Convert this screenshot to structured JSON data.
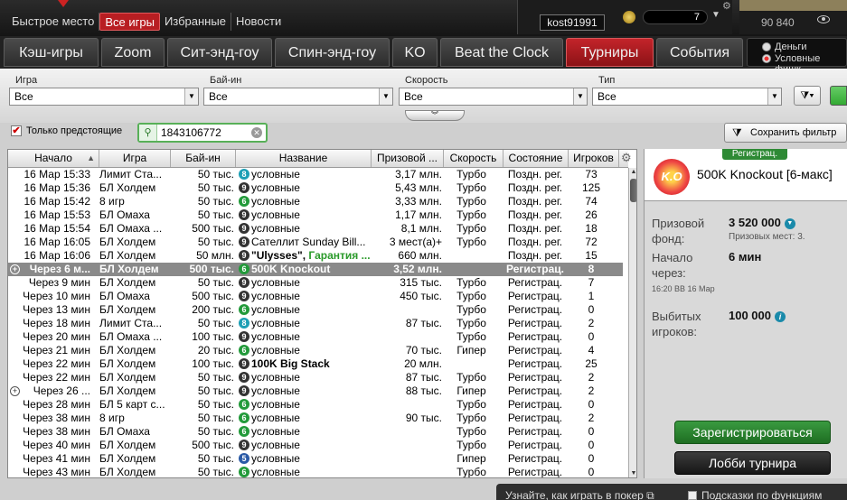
{
  "topnav": {
    "items": [
      "Быстрое место",
      "Все игры",
      "Избранные",
      "Новости"
    ],
    "active_index": 1
  },
  "user": {
    "name": "kost91991",
    "chips": "7",
    "balance": "90 840"
  },
  "tabs": [
    "Кэш-игры",
    "Zoom",
    "Сит-энд-гоу",
    "Спин-энд-гоу",
    "KO",
    "Beat the Clock",
    "Турниры",
    "События"
  ],
  "active_tab": "Турниры",
  "money": {
    "options": [
      "Деньги",
      "Условные фишк"
    ],
    "selected": "Условные фишк"
  },
  "filters": {
    "game": {
      "label": "Игра",
      "value": "Все"
    },
    "buyin": {
      "label": "Бай-ин",
      "value": "Все"
    },
    "speed": {
      "label": "Скорость",
      "value": "Все"
    },
    "type": {
      "label": "Тип",
      "value": "Все"
    }
  },
  "only_upcoming": {
    "label": "Только предстоящие",
    "checked": true
  },
  "search": {
    "value": "1843106772"
  },
  "save_filter_label": "Сохранить фильтр",
  "table": {
    "headers": [
      "Начало",
      "Игра",
      "Бай-ин",
      "Название",
      "Призовой ...",
      "Скорость",
      "Состояние",
      "Игроков"
    ],
    "rows": [
      {
        "start": "16 Мар  15:33",
        "game": "Лимит Ста...",
        "buyin": "50 тыс.",
        "badge": "8",
        "name": "условные",
        "name2": "",
        "prize": "3,17 млн.",
        "speed": "Турбо",
        "state": "Поздн. рег.",
        "players": "73"
      },
      {
        "start": "16 Мар  15:36",
        "game": "БЛ Холдем",
        "buyin": "50 тыс.",
        "badge": "9",
        "name": "условные",
        "name2": "",
        "prize": "5,43 млн.",
        "speed": "Турбо",
        "state": "Поздн. рег.",
        "players": "125"
      },
      {
        "start": "16 Мар  15:42",
        "game": "8 игр",
        "buyin": "50 тыс.",
        "badge": "6",
        "name": "условные",
        "name2": "",
        "prize": "3,33 млн.",
        "speed": "Турбо",
        "state": "Поздн. рег.",
        "players": "74"
      },
      {
        "start": "16 Мар  15:53",
        "game": "БЛ Омаха",
        "buyin": "50 тыс.",
        "badge": "9",
        "name": "условные",
        "name2": "",
        "prize": "1,17 млн.",
        "speed": "Турбо",
        "state": "Поздн. рег.",
        "players": "26"
      },
      {
        "start": "16 Мар  15:54",
        "game": "БЛ Омаха ...",
        "buyin": "500 тыс.",
        "badge": "9",
        "name": "условные",
        "name2": "",
        "prize": "8,1 млн.",
        "speed": "Турбо",
        "state": "Поздн. рег.",
        "players": "18"
      },
      {
        "start": "16 Мар  16:05",
        "game": "БЛ Холдем",
        "buyin": "50 тыс.",
        "badge": "9",
        "name": "Сателлит Sunday Bill...",
        "name2": "",
        "prize": "3 мест(а)+",
        "speed": "Турбо",
        "state": "Поздн. рег.",
        "players": "72"
      },
      {
        "start": "16 Мар  16:06",
        "game": "БЛ Холдем",
        "buyin": "50 млн.",
        "badge": "9",
        "name": "\"Ulysses\", ",
        "name2": "Гарантия ...",
        "prize": "660 млн.",
        "speed": "",
        "state": "Поздн. рег.",
        "players": "15",
        "bold": true
      },
      {
        "start": "Через 6 м...",
        "game": "БЛ Холдем",
        "buyin": "500 тыс.",
        "badge": "6",
        "name": "500K Knockout",
        "name2": "",
        "prize": "3,52 млн.",
        "speed": "",
        "state": "Регистрац.",
        "players": "8",
        "bold": true,
        "selected": true,
        "tick": true
      },
      {
        "start": "Через 9 мин",
        "game": "БЛ Холдем",
        "buyin": "50 тыс.",
        "badge": "9",
        "name": "условные",
        "name2": "",
        "prize": "315 тыс.",
        "speed": "Турбо",
        "state": "Регистрац.",
        "players": "7"
      },
      {
        "start": "Через 10 мин",
        "game": "БЛ Омаха",
        "buyin": "500 тыс.",
        "badge": "9",
        "name": "условные",
        "name2": "",
        "prize": "450 тыс.",
        "speed": "Турбо",
        "state": "Регистрац.",
        "players": "1"
      },
      {
        "start": "Через 13 мин",
        "game": "БЛ Холдем",
        "buyin": "200 тыс.",
        "badge": "6",
        "name": "условные",
        "name2": "",
        "prize": "",
        "speed": "Турбо",
        "state": "Регистрац.",
        "players": "0"
      },
      {
        "start": "Через 18 мин",
        "game": "Лимит Ста...",
        "buyin": "50 тыс.",
        "badge": "8",
        "name": "условные",
        "name2": "",
        "prize": "87 тыс.",
        "speed": "Турбо",
        "state": "Регистрац.",
        "players": "2"
      },
      {
        "start": "Через 20 мин",
        "game": "БЛ Омаха ...",
        "buyin": "100 тыс.",
        "badge": "9",
        "name": "условные",
        "name2": "",
        "prize": "",
        "speed": "Турбо",
        "state": "Регистрац.",
        "players": "0"
      },
      {
        "start": "Через 21 мин",
        "game": "БЛ Холдем",
        "buyin": "20 тыс.",
        "badge": "6",
        "name": "условные",
        "name2": "",
        "prize": "70 тыс.",
        "speed": "Гипер",
        "state": "Регистрац.",
        "players": "4"
      },
      {
        "start": "Через 22 мин",
        "game": "БЛ Холдем",
        "buyin": "100 тыс.",
        "badge": "9",
        "name": "100K Big Stack",
        "name2": "",
        "prize": "20 млн.",
        "speed": "",
        "state": "Регистрац.",
        "players": "25",
        "bold": true
      },
      {
        "start": "Через 22 мин",
        "game": "БЛ Холдем",
        "buyin": "50 тыс.",
        "badge": "9",
        "name": "условные",
        "name2": "",
        "prize": "87 тыс.",
        "speed": "Турбо",
        "state": "Регистрац.",
        "players": "2"
      },
      {
        "start": "Через 26 ...",
        "game": "БЛ Холдем",
        "buyin": "50 тыс.",
        "badge": "9",
        "name": "условные",
        "name2": "",
        "prize": "88 тыс.",
        "speed": "Гипер",
        "state": "Регистрац.",
        "players": "2",
        "tick": true
      },
      {
        "start": "Через 28 мин",
        "game": "БЛ 5 карт с...",
        "buyin": "50 тыс.",
        "badge": "6",
        "name": "условные",
        "name2": "",
        "prize": "",
        "speed": "Турбо",
        "state": "Регистрац.",
        "players": "0"
      },
      {
        "start": "Через 38 мин",
        "game": "8 игр",
        "buyin": "50 тыс.",
        "badge": "6",
        "name": "условные",
        "name2": "",
        "prize": "90 тыс.",
        "speed": "Турбо",
        "state": "Регистрац.",
        "players": "2"
      },
      {
        "start": "Через 38 мин",
        "game": "БЛ Омаха",
        "buyin": "50 тыс.",
        "badge": "6",
        "name": "условные",
        "name2": "",
        "prize": "",
        "speed": "Турбо",
        "state": "Регистрац.",
        "players": "0"
      },
      {
        "start": "Через 40 мин",
        "game": "БЛ Холдем",
        "buyin": "500 тыс.",
        "badge": "9",
        "name": "условные",
        "name2": "",
        "prize": "",
        "speed": "Турбо",
        "state": "Регистрац.",
        "players": "0"
      },
      {
        "start": "Через 41 мин",
        "game": "БЛ Холдем",
        "buyin": "50 тыс.",
        "badge": "5",
        "name": "условные",
        "name2": "",
        "prize": "",
        "speed": "Гипер",
        "state": "Регистрац.",
        "players": "0"
      },
      {
        "start": "Через 43 мин",
        "game": "БЛ Холдем",
        "buyin": "50 тыс.",
        "badge": "6",
        "name": "условные",
        "name2": "",
        "prize": "",
        "speed": "Турбо",
        "state": "Регистрац.",
        "players": "0"
      }
    ]
  },
  "panel": {
    "status_tag": "Регистрац.",
    "logo_text": "K.O",
    "title": "500K Knockout [6-макс]",
    "prize_label": "Призовой фонд:",
    "prize_value": "3 520 000",
    "prize_places": "Призовых мест: 3.",
    "start_label": "Начало через:",
    "start_value": "6 мин",
    "start_time": "16:20 ВВ 16 Мар",
    "eliminated_label": "Выбитых игроков:",
    "eliminated_value": "100 000",
    "register_button": "Зарегистрироваться",
    "lobby_button": "Лобби турнира"
  },
  "bottom": {
    "learn": "Узнайте, как играть в покер",
    "tips": "Подсказки по функциям"
  },
  "colors": {
    "accent_red": "#b81e22",
    "green": "#2e8a35",
    "selected_row": "#8a8a8a"
  }
}
